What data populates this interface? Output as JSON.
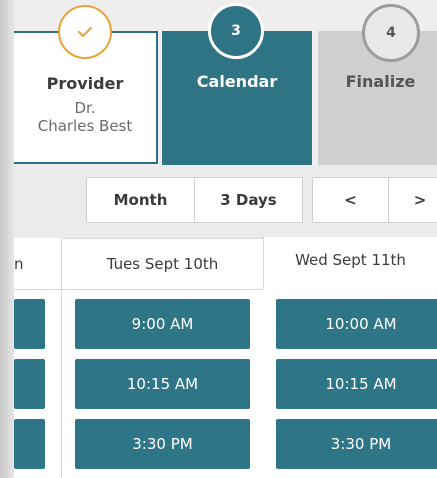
{
  "steps": [
    {
      "number": "✓",
      "title": "Provider",
      "provider_line1": "Dr.",
      "provider_line2": "Charles Best",
      "state": "complete"
    },
    {
      "number": "3",
      "title": "Calendar",
      "state": "active"
    },
    {
      "number": "4",
      "title": "Finalize",
      "state": "upcoming"
    }
  ],
  "view_toggle": {
    "month_label": "Month",
    "days_label": "3 Days"
  },
  "nav": {
    "prev_label": "<",
    "next_label": ">"
  },
  "columns": [
    {
      "header": "n"
    },
    {
      "header": "Tues Sept 10th",
      "slots": [
        "9:00 AM",
        "10:15 AM",
        "3:30 PM"
      ]
    },
    {
      "header": "Wed Sept 11th",
      "slots": [
        "10:00 AM",
        "10:15 AM",
        "3:30 PM"
      ]
    }
  ],
  "colors": {
    "primary": "#2f7484",
    "check_accent": "#e8a23a",
    "upcoming": "#cfcfcf"
  }
}
